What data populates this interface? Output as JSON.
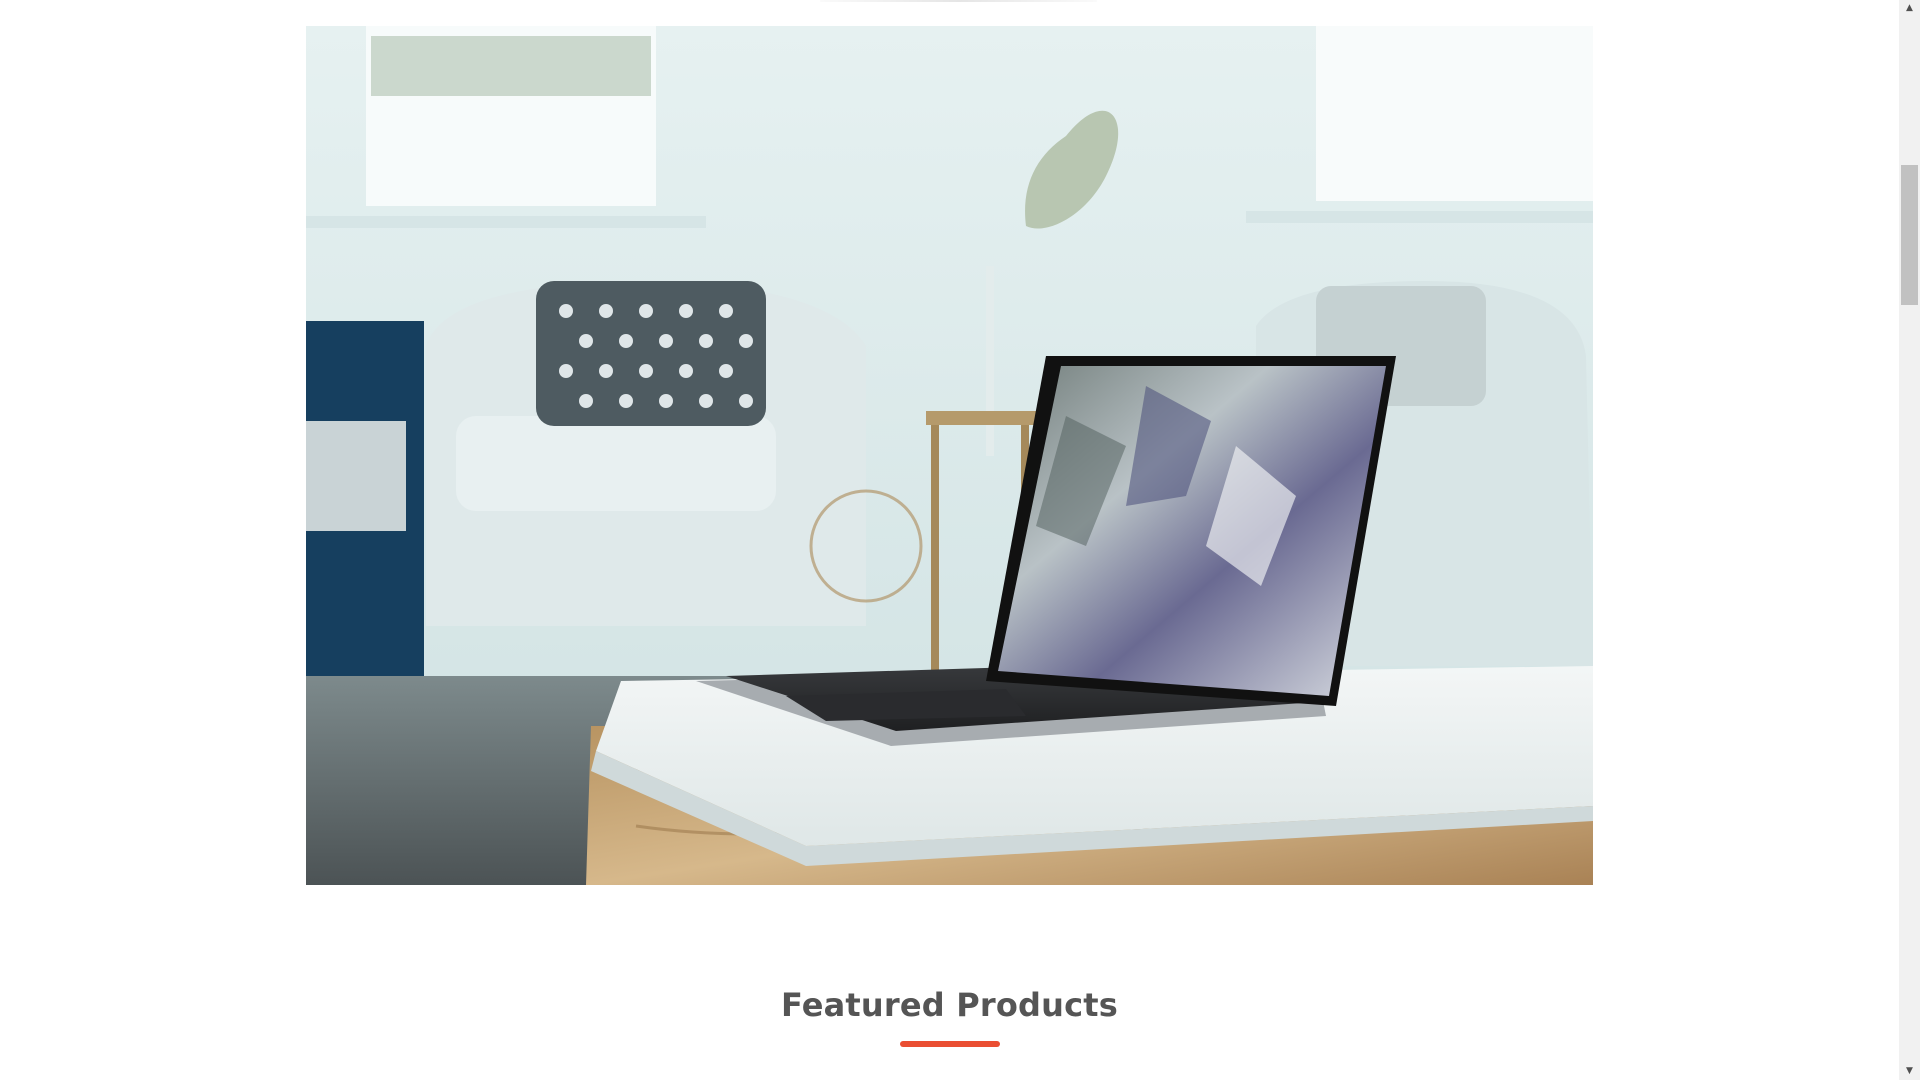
{
  "hero": {
    "image_name": "laptop-on-marble-table-living-room"
  },
  "featured": {
    "title": "Featured Products"
  },
  "colors": {
    "accent": "#ea4e32",
    "title": "#555555",
    "scroll_track": "#f1f1f1",
    "scroll_thumb": "#c1c1c1"
  },
  "scrollbar": {
    "up_glyph": "▲",
    "down_glyph": "▼"
  }
}
